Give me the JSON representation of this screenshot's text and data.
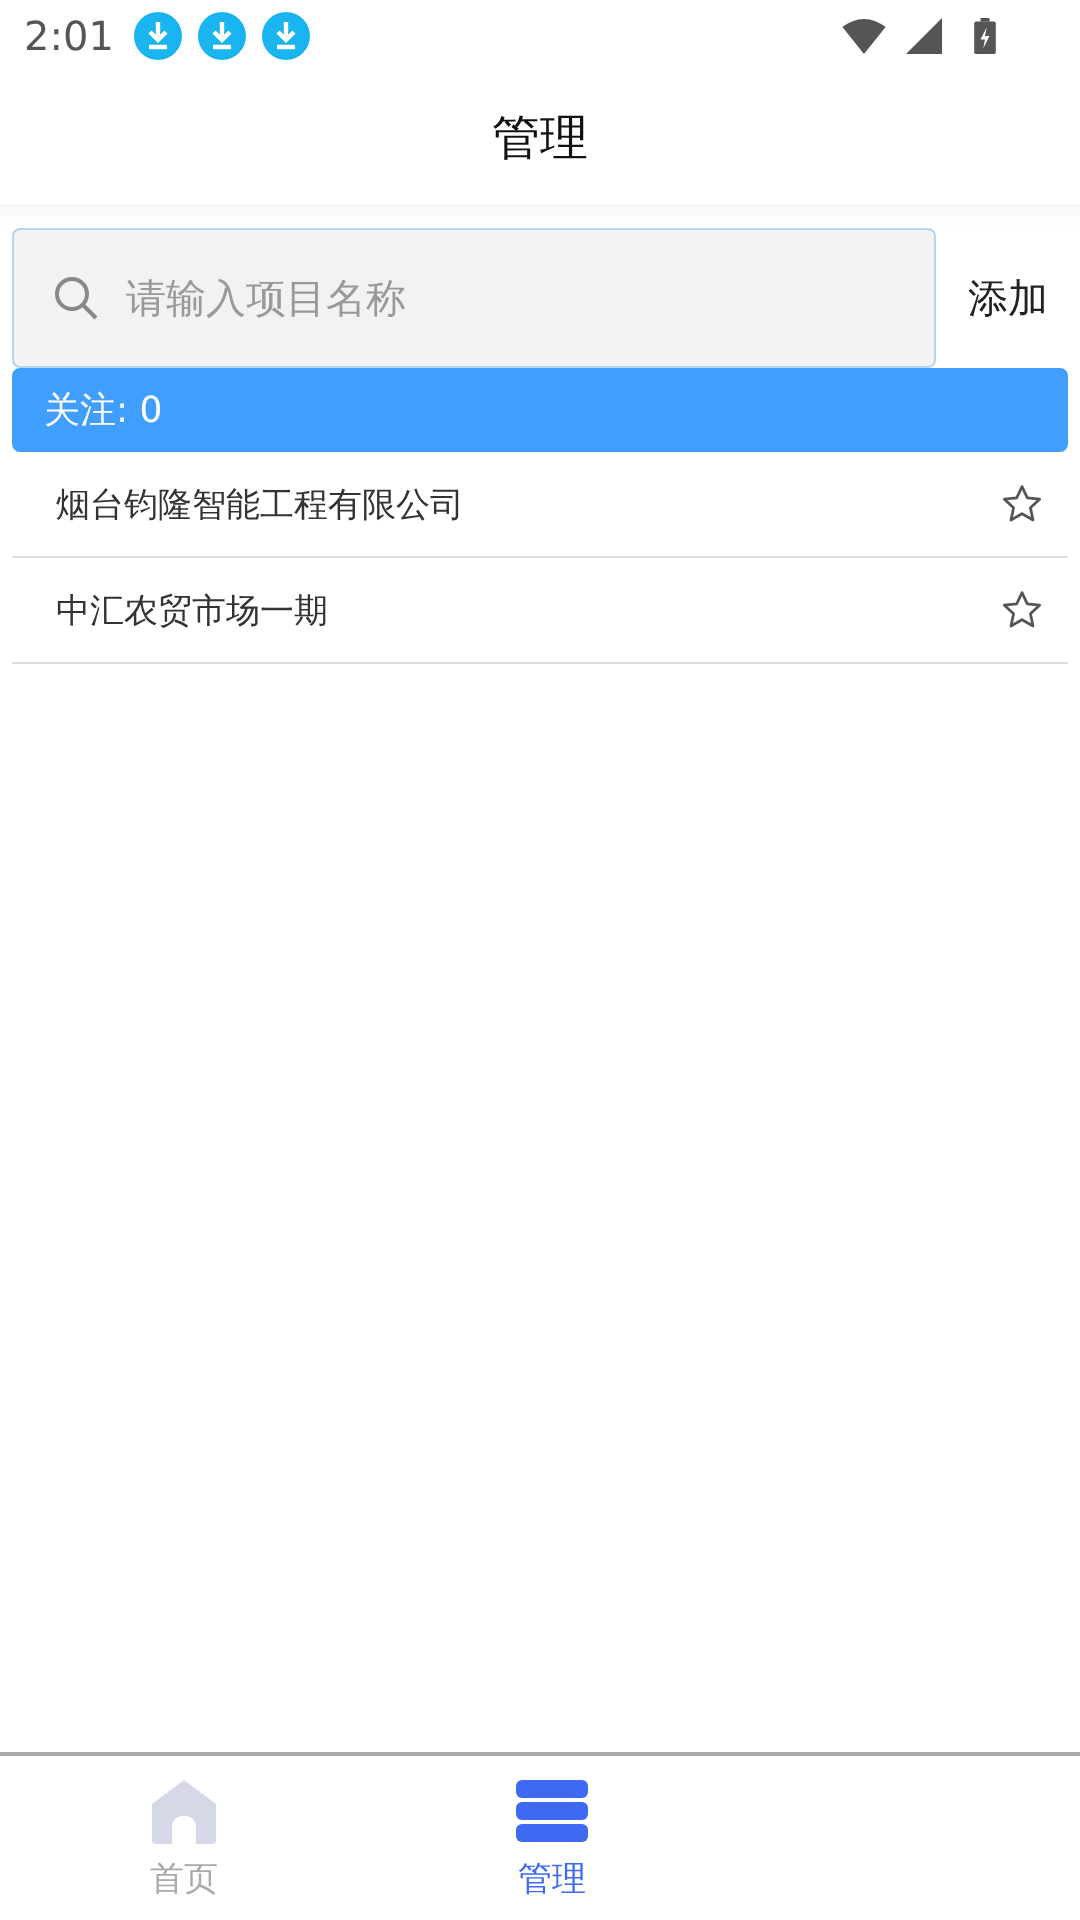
{
  "status_bar": {
    "time": "2:01",
    "notifications": [
      {
        "kind": "download"
      },
      {
        "kind": "download"
      },
      {
        "kind": "download"
      }
    ]
  },
  "header": {
    "title": "管理"
  },
  "search": {
    "placeholder": "请输入项目名称"
  },
  "add_button": {
    "label": "添加"
  },
  "follow_banner": {
    "label": "关注: 0"
  },
  "projects": [
    {
      "name": "烟台钧隆智能工程有限公司",
      "starred": false
    },
    {
      "name": "中汇农贸市场一期",
      "starred": false
    }
  ],
  "tabs": [
    {
      "label": "首页",
      "kind": "home",
      "selected": false
    },
    {
      "label": "管理",
      "kind": "manage",
      "selected": true
    }
  ]
}
